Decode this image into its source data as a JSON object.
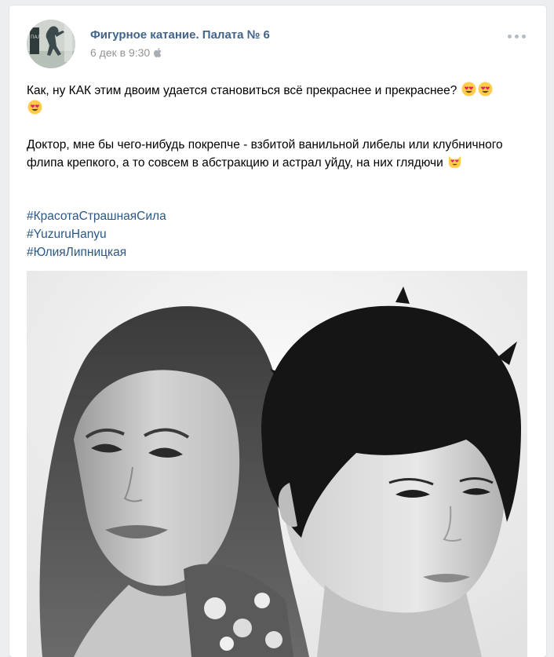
{
  "post": {
    "author": "Фигурное катание. Палата № 6",
    "date": "6 дек в 9:30",
    "platform_icon": "apple-icon",
    "menu_icon": "more-dots-icon",
    "text_line1": "Как, ну КАК этим двоим удается становиться всё прекраснее и прекраснее?",
    "text_para2": "Доктор, мне бы чего-нибудь покрепче - взбитой ванильной либелы или клубничного флипа крепкого, а то совсем в абстракцию и астрал уйду, на них глядючи",
    "emoji_1": "heart-eyes-emoji",
    "emoji_2": "heart-eyes-cat-emoji",
    "hashtags": [
      "#КрасотаСтрашнаяСила",
      "#YuzuruHanyu",
      "#ЮлияЛипницкая"
    ],
    "photo_kind": "black-and-white portrait photo of two figure skaters"
  },
  "colors": {
    "background": "#edeef0",
    "author": "#42648b",
    "hashtag": "#2a5885",
    "meta": "#939393"
  }
}
